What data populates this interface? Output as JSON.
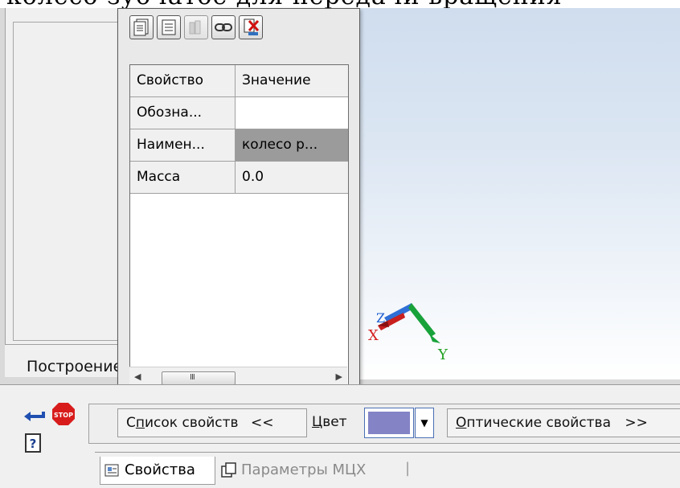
{
  "caption": {
    "text": "колесо зубчатое для передачи вращения"
  },
  "left_panel": {
    "tab_label": "Построение"
  },
  "properties_popup": {
    "toolbar_icons": [
      "properties-sheet-icon",
      "list-icon",
      "books-icon",
      "link-icon",
      "close-delete-icon"
    ],
    "columns": [
      "Свойство",
      "Значение"
    ],
    "rows": [
      {
        "property": "Обозна...",
        "value": ""
      },
      {
        "property": "Наимен...",
        "value": "колесо р..."
      },
      {
        "property": "Масса",
        "value": "0.0"
      }
    ],
    "scroll_thumb_label": "III"
  },
  "axes": {
    "x": "X",
    "y": "Y",
    "z": "Z"
  },
  "bottom_toolbar": {
    "properties_list": {
      "prefix": "С",
      "underlined": "п",
      "rest": "исок свойств",
      "arrow": "<<"
    },
    "color_label": {
      "underlined": "Ц",
      "rest": "вет"
    },
    "color_value": "#8383c6",
    "optical": {
      "underlined": "О",
      "rest": "птические свойства",
      "arrow": ">>"
    }
  },
  "bottom_tabs": [
    {
      "label": "Свойства",
      "icon": "properties-tab-icon",
      "active": true
    },
    {
      "label": "Параметры МЦХ",
      "icon": "mass-params-tab-icon",
      "active": false
    }
  ],
  "side_icons": [
    "enter-arrow-icon",
    "stop-icon",
    "help-icon"
  ],
  "colors": {
    "popup_bg": "#e9e9e9",
    "selected_row": "#9b9b9b",
    "axis_x": "#d42020",
    "axis_y": "#20a020",
    "axis_z": "#2060d0"
  }
}
